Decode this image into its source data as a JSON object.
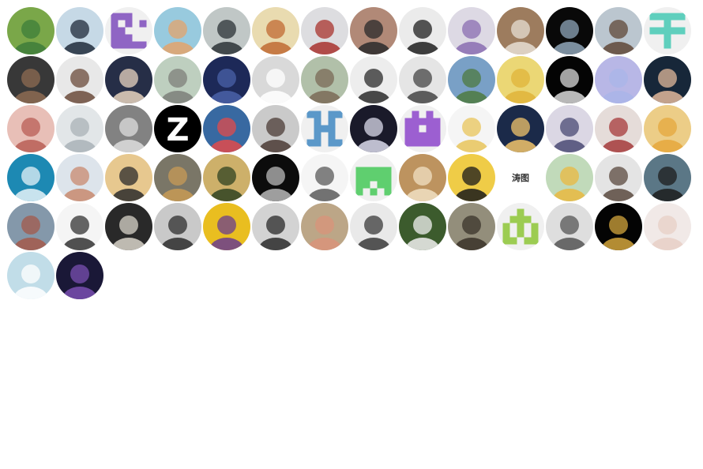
{
  "contributors": [
    {
      "kind": "photo",
      "bg": "#7fae4c",
      "fg": "#3e7d3a",
      "icon": "green-creature-avatar"
    },
    {
      "kind": "photo",
      "bg": "#cfe2f0",
      "fg": "#1f2a3a",
      "icon": "person-outdoor-avatar"
    },
    {
      "kind": "identicon",
      "bg": "#f0f0f0",
      "fg": "#8f65c4",
      "pattern": "1110010101110001110011111",
      "icon": "identicon-avatar"
    },
    {
      "kind": "photo",
      "bg": "#9fd3e8",
      "fg": "#e3a36b",
      "icon": "cat-beach-avatar"
    },
    {
      "kind": "photo",
      "bg": "#c8d0cf",
      "fg": "#2b3236",
      "icon": "person-suit-avatar"
    },
    {
      "kind": "photo",
      "bg": "#f3e4b8",
      "fg": "#c06a33",
      "icon": "anime-smile-avatar"
    },
    {
      "kind": "photo",
      "bg": "#e6e6ea",
      "fg": "#a8332e",
      "icon": "person-red-shirt-avatar"
    },
    {
      "kind": "photo",
      "bg": "#b98f7c",
      "fg": "#2a2a2a",
      "icon": "person-glasses-avatar"
    },
    {
      "kind": "photo",
      "bg": "#f5f5f5",
      "fg": "#1f1f1f",
      "icon": "person-beard-avatar"
    },
    {
      "kind": "photo",
      "bg": "#e6e2ee",
      "fg": "#8a6cb2",
      "icon": "anime-purple-hair-avatar"
    },
    {
      "kind": "photo",
      "bg": "#a48262",
      "fg": "#e7dfd4",
      "icon": "dog-desk-avatar"
    },
    {
      "kind": "photo",
      "bg": "#0a0a0a",
      "fg": "#8fa6b9",
      "icon": "cartoon-monster-avatar"
    },
    {
      "kind": "photo",
      "bg": "#c3cfd8",
      "fg": "#5f4737",
      "icon": "person-portrait-avatar"
    },
    {
      "kind": "identicon",
      "bg": "#f0f0f0",
      "fg": "#5fcfbd",
      "pattern": "1111100100111110010000100",
      "icon": "identicon-avatar"
    },
    {
      "kind": "photo",
      "bg": "#3b3b3b",
      "fg": "#8d6b52",
      "icon": "person-rocks-avatar"
    },
    {
      "kind": "photo",
      "bg": "#f2f2f2",
      "fg": "#6b4b3b",
      "icon": "person-beard-light-avatar"
    },
    {
      "kind": "photo",
      "bg": "#28304a",
      "fg": "#e8d4c0",
      "icon": "anime-detective-avatar"
    },
    {
      "kind": "photo",
      "bg": "#c6d8c7",
      "fg": "#7d7f79",
      "icon": "street-view-avatar"
    },
    {
      "kind": "photo",
      "bg": "#1f2b5c",
      "fg": "#4a62a8",
      "icon": "night-sky-avatar"
    },
    {
      "kind": "photo",
      "bg": "#e2e2e2",
      "fg": "#ffffff",
      "icon": "panda-cartoon-avatar"
    },
    {
      "kind": "photo",
      "bg": "#b9c8b0",
      "fg": "#7b6a57",
      "icon": "people-group-avatar"
    },
    {
      "kind": "photo",
      "bg": "#f7f7f7",
      "fg": "#2a2a2a",
      "icon": "person-dark-shirt-avatar"
    },
    {
      "kind": "photo",
      "bg": "#efefef",
      "fg": "#444444",
      "icon": "manga-sketch-avatar"
    },
    {
      "kind": "photo",
      "bg": "#7ea7cf",
      "fg": "#4e7a3f",
      "icon": "park-view-avatar"
    },
    {
      "kind": "photo",
      "bg": "#f5e07a",
      "fg": "#e0b43a",
      "icon": "psyduck-avatar"
    },
    {
      "kind": "photo",
      "bg": "#050505",
      "fg": "#d8d8d8",
      "icon": "dark-ladder-avatar"
    },
    {
      "kind": "photo",
      "bg": "#c0bff0",
      "fg": "#a9b5e8",
      "icon": "lavender-sky-avatar"
    },
    {
      "kind": "photo",
      "bg": "#18293c",
      "fg": "#e2b99b",
      "icon": "person-glasses-dark-avatar"
    },
    {
      "kind": "photo",
      "bg": "#f2c7bf",
      "fg": "#b95e56",
      "icon": "anime-girl-avatar"
    },
    {
      "kind": "photo",
      "bg": "#ecf0f2",
      "fg": "#a9b1b7",
      "icon": "anime-white-hair-avatar"
    },
    {
      "kind": "photo",
      "bg": "#888888",
      "fg": "#dedede",
      "icon": "white-cat-avatar"
    },
    {
      "kind": "letter",
      "bg": "#000000",
      "fg": "#ffffff",
      "glyph": "Z",
      "icon": "letter-z-avatar"
    },
    {
      "kind": "photo",
      "bg": "#3b6ea8",
      "fg": "#e24b4b",
      "icon": "doraemon-avatar"
    },
    {
      "kind": "photo",
      "bg": "#d3d3d3",
      "fg": "#4b3b35",
      "icon": "person-jacket-avatar"
    },
    {
      "kind": "identicon",
      "bg": "#f0f0f0",
      "fg": "#5b98c9",
      "pattern": "1101101010011100101011011",
      "icon": "identicon-avatar"
    },
    {
      "kind": "photo",
      "bg": "#1c1c2c",
      "fg": "#dbdbeb",
      "icon": "dark-scene-avatar"
    },
    {
      "kind": "identicon",
      "bg": "#f0f0f0",
      "fg": "#9c5fd1",
      "pattern": "0101011111110111111111111",
      "icon": "identicon-avatar"
    },
    {
      "kind": "photo",
      "bg": "#ffffff",
      "fg": "#e8c45a",
      "icon": "teddy-bear-avatar"
    },
    {
      "kind": "photo",
      "bg": "#1d2c4c",
      "fg": "#f1c46b",
      "icon": "lanterns-night-avatar"
    },
    {
      "kind": "photo",
      "bg": "#e4e0ee",
      "fg": "#4a4a74",
      "icon": "anime-dark-hair-avatar"
    },
    {
      "kind": "photo",
      "bg": "#efe5e2",
      "fg": "#a53a3a",
      "icon": "anime-red-robe-avatar"
    },
    {
      "kind": "photo",
      "bg": "#f6d68d",
      "fg": "#e6a73c",
      "icon": "anime-blonde-avatar"
    },
    {
      "kind": "photo",
      "bg": "#1f8fbb",
      "fg": "#e6f3f8",
      "icon": "water-bottle-avatar"
    },
    {
      "kind": "photo",
      "bg": "#e7eef5",
      "fg": "#c88a6f",
      "icon": "person-smile-avatar"
    },
    {
      "kind": "photo",
      "bg": "#f1d195",
      "fg": "#2b2b2b",
      "icon": "anime-dark-boy-avatar"
    },
    {
      "kind": "photo",
      "bg": "#7f7b6c",
      "fg": "#c89b55",
      "icon": "person-sitting-avatar"
    },
    {
      "kind": "photo",
      "bg": "#d6b86f",
      "fg": "#2f4321",
      "icon": "tree-sunset-avatar"
    },
    {
      "kind": "photo",
      "bg": "#0d0d0d",
      "fg": "#b9b9b9",
      "icon": "anime-gray-hair-avatar"
    },
    {
      "kind": "photo",
      "bg": "#ffffff",
      "fg": "#5a5a5a",
      "icon": "anime-sketch-avatar"
    },
    {
      "kind": "identicon",
      "bg": "#f0f0f0",
      "fg": "#5fcf6f",
      "pattern": "0000011111111111101110101",
      "icon": "identicon-avatar"
    },
    {
      "kind": "photo",
      "bg": "#c59a63",
      "fg": "#f1e0c3",
      "icon": "shiba-dog-avatar"
    },
    {
      "kind": "photo",
      "bg": "#f9d54a",
      "fg": "#1a1a1a",
      "icon": "cartoon-glasses-avatar"
    },
    {
      "kind": "letter",
      "bg": "#ffffff",
      "fg": "#333333",
      "glyph": "涛图",
      "icon": "text-logo-avatar"
    },
    {
      "kind": "photo",
      "bg": "#c9e3c2",
      "fg": "#e9b840",
      "icon": "cartoon-king-avatar"
    },
    {
      "kind": "photo",
      "bg": "#eeeeee",
      "fg": "#5b4a3f",
      "icon": "person-gray-shirt-avatar"
    },
    {
      "kind": "photo",
      "bg": "#5f7c8c",
      "fg": "#1c1c1c",
      "icon": "person-dark-avatar"
    },
    {
      "kind": "photo",
      "bg": "#8a9fb1",
      "fg": "#a3594b",
      "icon": "fox-character-avatar"
    },
    {
      "kind": "photo",
      "bg": "#ffffff",
      "fg": "#333333",
      "icon": "sheep-doodle-avatar"
    },
    {
      "kind": "photo",
      "bg": "#2b2b2b",
      "fg": "#d8d4c9",
      "icon": "anime-android-avatar"
    },
    {
      "kind": "photo",
      "bg": "#d2d2d2",
      "fg": "#2d2d2d",
      "icon": "manga-boy-avatar"
    },
    {
      "kind": "photo",
      "bg": "#f3c622",
      "fg": "#6a3d8e",
      "icon": "ninja-turtle-avatar"
    },
    {
      "kind": "photo",
      "bg": "#dcdcdc",
      "fg": "#2a2a2a",
      "icon": "person-bald-avatar"
    },
    {
      "kind": "photo",
      "bg": "#c4ad8d",
      "fg": "#d9937a",
      "icon": "person-blue-shirt-avatar"
    },
    {
      "kind": "photo",
      "bg": "#f3f3f3",
      "fg": "#3a3a3a",
      "icon": "person-short-hair-avatar"
    },
    {
      "kind": "photo",
      "bg": "#3f5f2f",
      "fg": "#f0f0f0",
      "icon": "person-outdoor-dark-avatar"
    },
    {
      "kind": "photo",
      "bg": "#9a9480",
      "fg": "#3a3329",
      "icon": "person-wall-avatar"
    },
    {
      "kind": "identicon",
      "bg": "#f0f0f0",
      "fg": "#9ccc52",
      "pattern": "0010001110101011010111011",
      "icon": "identicon-avatar"
    },
    {
      "kind": "photo",
      "bg": "#e8e8e8",
      "fg": "#555555",
      "icon": "ink-drawing-avatar"
    },
    {
      "kind": "photo",
      "bg": "#050505",
      "fg": "#d2a43c",
      "icon": "gold-logo-avatar"
    },
    {
      "kind": "photo",
      "bg": "#fbf3f1",
      "fg": "#e7cfc6",
      "icon": "pastel-sketch-avatar"
    },
    {
      "kind": "photo",
      "bg": "#c9e6f2",
      "fg": "#ffffff",
      "icon": "anime-white-boy-avatar"
    },
    {
      "kind": "photo",
      "bg": "#1c1a3a",
      "fg": "#7a4fb2",
      "icon": "sailor-anime-avatar"
    }
  ]
}
